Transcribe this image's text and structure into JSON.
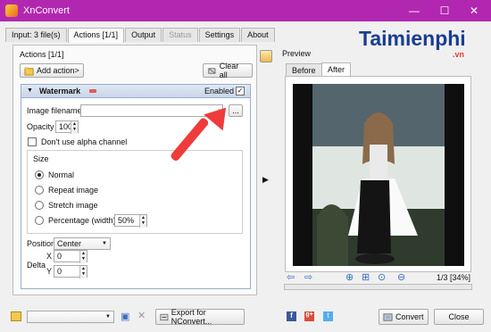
{
  "window": {
    "title": "XnConvert",
    "minimize": "—",
    "maximize": "☐",
    "close": "✕"
  },
  "tabs": [
    {
      "label": "Input: 3 file(s)"
    },
    {
      "label": "Actions [1/1]"
    },
    {
      "label": "Output"
    },
    {
      "label": "Status"
    },
    {
      "label": "Settings"
    },
    {
      "label": "About"
    }
  ],
  "actions_panel": {
    "title": "Actions [1/1]",
    "add_action": "Add action>",
    "clear_all": "Clear all",
    "action": {
      "name": "Watermark",
      "enabled_label": "Enabled",
      "enabled": true,
      "image_filename_label": "Image filename",
      "image_filename_value": "",
      "browse_label": "...",
      "opacity_label": "Opacity",
      "opacity_value": "100",
      "alpha_label": "Don't use alpha channel",
      "size_group_label": "Size",
      "size_options": [
        "Normal",
        "Repeat image",
        "Stretch image",
        "Percentage (width)"
      ],
      "size_selected": "Normal",
      "percentage_value": "50%",
      "position_label": "Position",
      "position_value": "Center",
      "delta_label": "Delta",
      "x_label": "X",
      "x_value": "0",
      "y_label": "Y",
      "y_value": "0"
    }
  },
  "preview": {
    "label": "Preview",
    "tabs": [
      "Before",
      "After"
    ],
    "active_tab": "After",
    "page_info": "1/3 [34%]"
  },
  "bottom": {
    "preset_value": "",
    "export_label": "Export for NConvert...",
    "convert_label": "Convert",
    "close_label": "Close"
  },
  "watermark_logo": {
    "text": "Taimienphi",
    "suffix": ".vn"
  },
  "colors": {
    "titlebar": "#b227b0",
    "arrow": "#ef3b3b",
    "logo": "#1a3d8f"
  }
}
